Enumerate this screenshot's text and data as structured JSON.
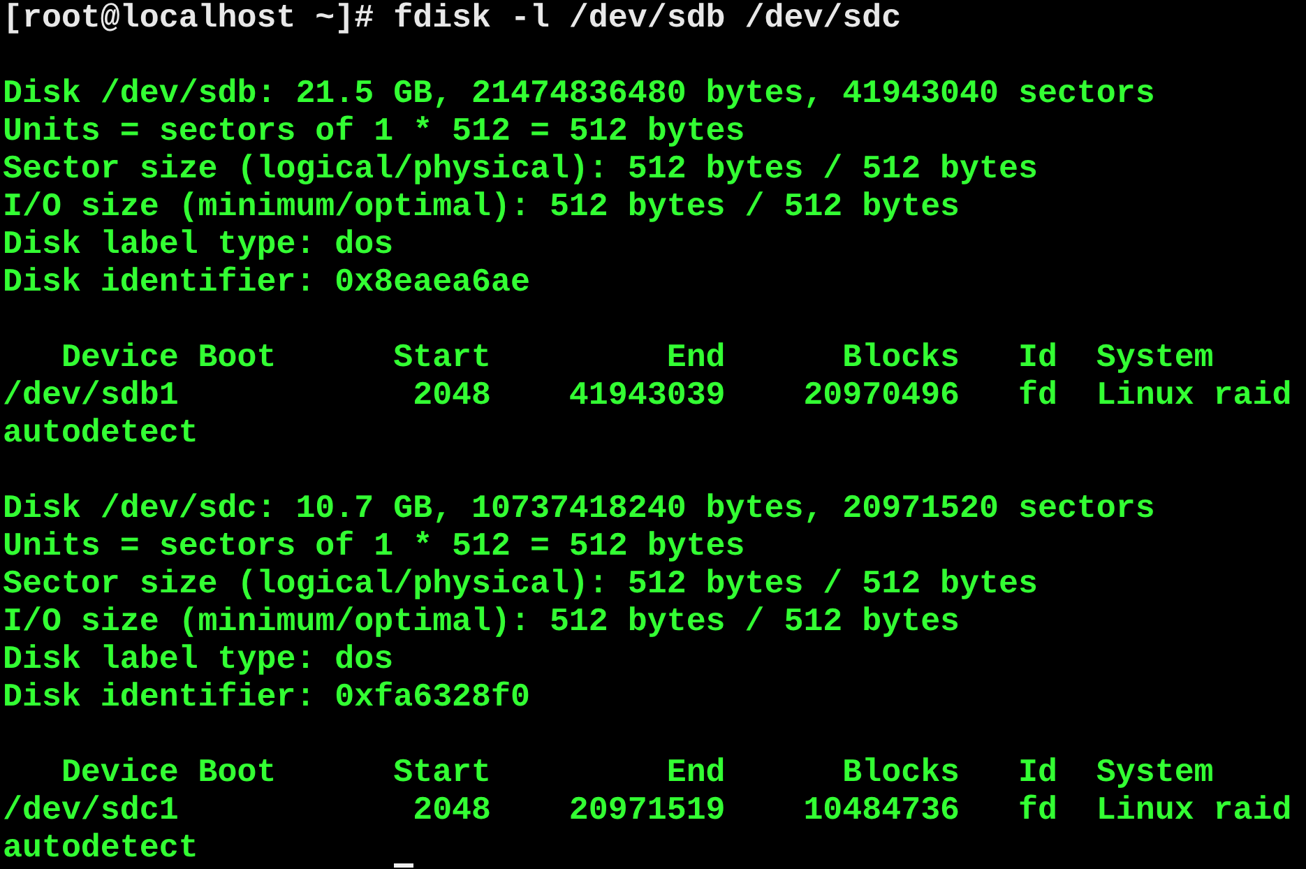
{
  "terminal": {
    "blocks": [
      {
        "kind": "command",
        "lines": [
          "[root@localhost ~]# fdisk -l /dev/sdb /dev/sdc"
        ]
      },
      {
        "kind": "output",
        "lines": [
          "Disk /dev/sdb: 21.5 GB, 21474836480 bytes, 41943040 sectors",
          "Units = sectors of 1 * 512 = 512 bytes",
          "Sector size (logical/physical): 512 bytes / 512 bytes",
          "I/O size (minimum/optimal): 512 bytes / 512 bytes",
          "Disk label type: dos",
          "Disk identifier: 0x8eaea6ae"
        ]
      },
      {
        "kind": "output",
        "lines": [
          "   Device Boot      Start         End      Blocks   Id  System",
          "/dev/sdb1            2048    41943039    20970496   fd  Linux raid",
          "autodetect"
        ]
      },
      {
        "kind": "output",
        "lines": [
          "Disk /dev/sdc: 10.7 GB, 10737418240 bytes, 20971520 sectors",
          "Units = sectors of 1 * 512 = 512 bytes",
          "Sector size (logical/physical): 512 bytes / 512 bytes",
          "I/O size (minimum/optimal): 512 bytes / 512 bytes",
          "Disk label type: dos",
          "Disk identifier: 0xfa6328f0"
        ]
      },
      {
        "kind": "output",
        "lines": [
          "   Device Boot      Start         End      Blocks   Id  System",
          "/dev/sdc1            2048    20971519    10484736   fd  Linux raid",
          "autodetect"
        ]
      }
    ]
  }
}
